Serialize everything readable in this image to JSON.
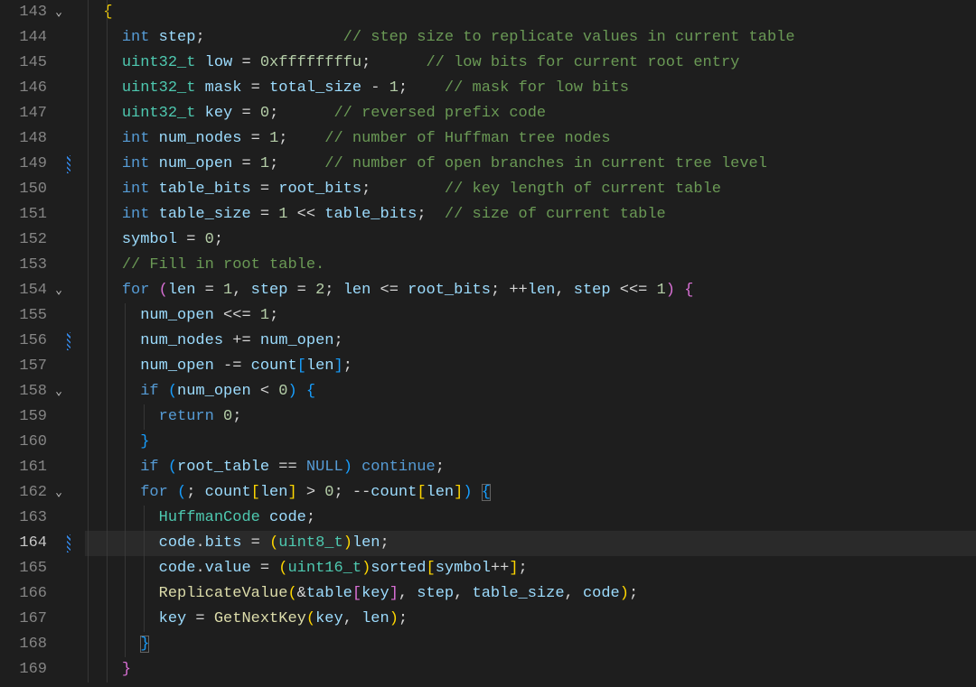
{
  "lines": [
    {
      "num": 143,
      "fold": "v",
      "marker": false,
      "indent": 1,
      "current": false,
      "guides": [
        0,
        1
      ],
      "tokens": [
        {
          "t": "{",
          "c": "braceY"
        }
      ]
    },
    {
      "num": 144,
      "fold": "",
      "marker": false,
      "indent": 2,
      "current": false,
      "guides": [
        0,
        1
      ],
      "tokens": [
        {
          "t": "int",
          "c": "keyword"
        },
        {
          "t": " ",
          "c": "default"
        },
        {
          "t": "step",
          "c": "var"
        },
        {
          "t": ";",
          "c": "punc"
        },
        {
          "t": "               ",
          "c": "default"
        },
        {
          "t": "// step size to replicate values in current table",
          "c": "comment"
        }
      ]
    },
    {
      "num": 145,
      "fold": "",
      "marker": false,
      "indent": 2,
      "current": false,
      "guides": [
        0,
        1
      ],
      "tokens": [
        {
          "t": "uint32_t",
          "c": "type"
        },
        {
          "t": " ",
          "c": "default"
        },
        {
          "t": "low",
          "c": "var"
        },
        {
          "t": " = ",
          "c": "punc"
        },
        {
          "t": "0xffffffffu",
          "c": "number"
        },
        {
          "t": ";",
          "c": "punc"
        },
        {
          "t": "      ",
          "c": "default"
        },
        {
          "t": "// low bits for current root entry",
          "c": "comment"
        }
      ]
    },
    {
      "num": 146,
      "fold": "",
      "marker": false,
      "indent": 2,
      "current": false,
      "guides": [
        0,
        1
      ],
      "tokens": [
        {
          "t": "uint32_t",
          "c": "type"
        },
        {
          "t": " ",
          "c": "default"
        },
        {
          "t": "mask",
          "c": "var"
        },
        {
          "t": " = ",
          "c": "punc"
        },
        {
          "t": "total_size",
          "c": "var"
        },
        {
          "t": " - ",
          "c": "punc"
        },
        {
          "t": "1",
          "c": "number"
        },
        {
          "t": ";",
          "c": "punc"
        },
        {
          "t": "    ",
          "c": "default"
        },
        {
          "t": "// mask for low bits",
          "c": "comment"
        }
      ]
    },
    {
      "num": 147,
      "fold": "",
      "marker": false,
      "indent": 2,
      "current": false,
      "guides": [
        0,
        1
      ],
      "tokens": [
        {
          "t": "uint32_t",
          "c": "type"
        },
        {
          "t": " ",
          "c": "default"
        },
        {
          "t": "key",
          "c": "var"
        },
        {
          "t": " = ",
          "c": "punc"
        },
        {
          "t": "0",
          "c": "number"
        },
        {
          "t": ";",
          "c": "punc"
        },
        {
          "t": "      ",
          "c": "default"
        },
        {
          "t": "// reversed prefix code",
          "c": "comment"
        }
      ]
    },
    {
      "num": 148,
      "fold": "",
      "marker": false,
      "indent": 2,
      "current": false,
      "guides": [
        0,
        1
      ],
      "tokens": [
        {
          "t": "int",
          "c": "keyword"
        },
        {
          "t": " ",
          "c": "default"
        },
        {
          "t": "num_nodes",
          "c": "var"
        },
        {
          "t": " = ",
          "c": "punc"
        },
        {
          "t": "1",
          "c": "number"
        },
        {
          "t": ";",
          "c": "punc"
        },
        {
          "t": "    ",
          "c": "default"
        },
        {
          "t": "// number of Huffman tree nodes",
          "c": "comment"
        }
      ]
    },
    {
      "num": 149,
      "fold": "",
      "marker": true,
      "indent": 2,
      "current": false,
      "guides": [
        0,
        1
      ],
      "tokens": [
        {
          "t": "int",
          "c": "keyword"
        },
        {
          "t": " ",
          "c": "default"
        },
        {
          "t": "num_open",
          "c": "var"
        },
        {
          "t": " = ",
          "c": "punc"
        },
        {
          "t": "1",
          "c": "number"
        },
        {
          "t": ";",
          "c": "punc"
        },
        {
          "t": "     ",
          "c": "default"
        },
        {
          "t": "// number of open branches in current tree level",
          "c": "comment"
        }
      ]
    },
    {
      "num": 150,
      "fold": "",
      "marker": false,
      "indent": 2,
      "current": false,
      "guides": [
        0,
        1
      ],
      "tokens": [
        {
          "t": "int",
          "c": "keyword"
        },
        {
          "t": " ",
          "c": "default"
        },
        {
          "t": "table_bits",
          "c": "var"
        },
        {
          "t": " = ",
          "c": "punc"
        },
        {
          "t": "root_bits",
          "c": "var"
        },
        {
          "t": ";",
          "c": "punc"
        },
        {
          "t": "        ",
          "c": "default"
        },
        {
          "t": "// key length of current table",
          "c": "comment"
        }
      ]
    },
    {
      "num": 151,
      "fold": "",
      "marker": false,
      "indent": 2,
      "current": false,
      "guides": [
        0,
        1
      ],
      "tokens": [
        {
          "t": "int",
          "c": "keyword"
        },
        {
          "t": " ",
          "c": "default"
        },
        {
          "t": "table_size",
          "c": "var"
        },
        {
          "t": " = ",
          "c": "punc"
        },
        {
          "t": "1",
          "c": "number"
        },
        {
          "t": " << ",
          "c": "punc"
        },
        {
          "t": "table_bits",
          "c": "var"
        },
        {
          "t": ";",
          "c": "punc"
        },
        {
          "t": "  ",
          "c": "default"
        },
        {
          "t": "// size of current table",
          "c": "comment"
        }
      ]
    },
    {
      "num": 152,
      "fold": "",
      "marker": false,
      "indent": 2,
      "current": false,
      "guides": [
        0,
        1
      ],
      "tokens": [
        {
          "t": "symbol",
          "c": "var"
        },
        {
          "t": " = ",
          "c": "punc"
        },
        {
          "t": "0",
          "c": "number"
        },
        {
          "t": ";",
          "c": "punc"
        }
      ]
    },
    {
      "num": 153,
      "fold": "",
      "marker": false,
      "indent": 2,
      "current": false,
      "guides": [
        0,
        1
      ],
      "tokens": [
        {
          "t": "// Fill in root table.",
          "c": "comment"
        }
      ]
    },
    {
      "num": 154,
      "fold": "v",
      "marker": false,
      "indent": 2,
      "current": false,
      "guides": [
        0,
        1
      ],
      "tokens": [
        {
          "t": "for",
          "c": "keyword"
        },
        {
          "t": " ",
          "c": "default"
        },
        {
          "t": "(",
          "c": "braceP"
        },
        {
          "t": "len",
          "c": "var"
        },
        {
          "t": " = ",
          "c": "punc"
        },
        {
          "t": "1",
          "c": "number"
        },
        {
          "t": ", ",
          "c": "punc"
        },
        {
          "t": "step",
          "c": "var"
        },
        {
          "t": " = ",
          "c": "punc"
        },
        {
          "t": "2",
          "c": "number"
        },
        {
          "t": "; ",
          "c": "punc"
        },
        {
          "t": "len",
          "c": "var"
        },
        {
          "t": " <= ",
          "c": "punc"
        },
        {
          "t": "root_bits",
          "c": "var"
        },
        {
          "t": "; ",
          "c": "punc"
        },
        {
          "t": "++",
          "c": "punc"
        },
        {
          "t": "len",
          "c": "var"
        },
        {
          "t": ", ",
          "c": "punc"
        },
        {
          "t": "step",
          "c": "var"
        },
        {
          "t": " <<= ",
          "c": "punc"
        },
        {
          "t": "1",
          "c": "number"
        },
        {
          "t": ")",
          "c": "braceP"
        },
        {
          "t": " ",
          "c": "default"
        },
        {
          "t": "{",
          "c": "braceP"
        }
      ]
    },
    {
      "num": 155,
      "fold": "",
      "marker": false,
      "indent": 3,
      "current": false,
      "guides": [
        0,
        1,
        2
      ],
      "tokens": [
        {
          "t": "num_open",
          "c": "var"
        },
        {
          "t": " <<= ",
          "c": "punc"
        },
        {
          "t": "1",
          "c": "number"
        },
        {
          "t": ";",
          "c": "punc"
        }
      ]
    },
    {
      "num": 156,
      "fold": "",
      "marker": true,
      "indent": 3,
      "current": false,
      "guides": [
        0,
        1,
        2
      ],
      "tokens": [
        {
          "t": "num_nodes",
          "c": "var"
        },
        {
          "t": " += ",
          "c": "punc"
        },
        {
          "t": "num_open",
          "c": "var"
        },
        {
          "t": ";",
          "c": "punc"
        }
      ]
    },
    {
      "num": 157,
      "fold": "",
      "marker": false,
      "indent": 3,
      "current": false,
      "guides": [
        0,
        1,
        2
      ],
      "tokens": [
        {
          "t": "num_open",
          "c": "var"
        },
        {
          "t": " -= ",
          "c": "punc"
        },
        {
          "t": "count",
          "c": "var"
        },
        {
          "t": "[",
          "c": "braceB"
        },
        {
          "t": "len",
          "c": "var"
        },
        {
          "t": "]",
          "c": "braceB"
        },
        {
          "t": ";",
          "c": "punc"
        }
      ]
    },
    {
      "num": 158,
      "fold": "v",
      "marker": false,
      "indent": 3,
      "current": false,
      "guides": [
        0,
        1,
        2
      ],
      "tokens": [
        {
          "t": "if",
          "c": "keyword"
        },
        {
          "t": " ",
          "c": "default"
        },
        {
          "t": "(",
          "c": "braceB"
        },
        {
          "t": "num_open",
          "c": "var"
        },
        {
          "t": " < ",
          "c": "punc"
        },
        {
          "t": "0",
          "c": "number"
        },
        {
          "t": ")",
          "c": "braceB"
        },
        {
          "t": " ",
          "c": "default"
        },
        {
          "t": "{",
          "c": "braceB"
        }
      ]
    },
    {
      "num": 159,
      "fold": "",
      "marker": false,
      "indent": 4,
      "current": false,
      "guides": [
        0,
        1,
        2,
        3
      ],
      "tokens": [
        {
          "t": "return",
          "c": "keyword"
        },
        {
          "t": " ",
          "c": "default"
        },
        {
          "t": "0",
          "c": "number"
        },
        {
          "t": ";",
          "c": "punc"
        }
      ]
    },
    {
      "num": 160,
      "fold": "",
      "marker": false,
      "indent": 3,
      "current": false,
      "guides": [
        0,
        1,
        2
      ],
      "tokens": [
        {
          "t": "}",
          "c": "braceB"
        }
      ]
    },
    {
      "num": 161,
      "fold": "",
      "marker": false,
      "indent": 3,
      "current": false,
      "guides": [
        0,
        1,
        2
      ],
      "tokens": [
        {
          "t": "if",
          "c": "keyword"
        },
        {
          "t": " ",
          "c": "default"
        },
        {
          "t": "(",
          "c": "braceB"
        },
        {
          "t": "root_table",
          "c": "var"
        },
        {
          "t": " == ",
          "c": "punc"
        },
        {
          "t": "NULL",
          "c": "const"
        },
        {
          "t": ")",
          "c": "braceB"
        },
        {
          "t": " ",
          "c": "default"
        },
        {
          "t": "continue",
          "c": "keyword"
        },
        {
          "t": ";",
          "c": "punc"
        }
      ]
    },
    {
      "num": 162,
      "fold": "v",
      "marker": false,
      "indent": 3,
      "current": false,
      "guides": [
        0,
        1,
        2
      ],
      "tokens": [
        {
          "t": "for",
          "c": "keyword"
        },
        {
          "t": " ",
          "c": "default"
        },
        {
          "t": "(",
          "c": "braceB"
        },
        {
          "t": "; ",
          "c": "punc"
        },
        {
          "t": "count",
          "c": "var"
        },
        {
          "t": "[",
          "c": "braceY"
        },
        {
          "t": "len",
          "c": "var"
        },
        {
          "t": "]",
          "c": "braceY"
        },
        {
          "t": " > ",
          "c": "punc"
        },
        {
          "t": "0",
          "c": "number"
        },
        {
          "t": "; ",
          "c": "punc"
        },
        {
          "t": "--",
          "c": "punc"
        },
        {
          "t": "count",
          "c": "var"
        },
        {
          "t": "[",
          "c": "braceY"
        },
        {
          "t": "len",
          "c": "var"
        },
        {
          "t": "]",
          "c": "braceY"
        },
        {
          "t": ")",
          "c": "braceB"
        },
        {
          "t": " ",
          "c": "default"
        },
        {
          "t": "{",
          "c": "braceB",
          "hl": true
        }
      ]
    },
    {
      "num": 163,
      "fold": "",
      "marker": false,
      "indent": 4,
      "current": false,
      "guides": [
        0,
        1,
        2,
        3
      ],
      "tokens": [
        {
          "t": "HuffmanCode",
          "c": "type"
        },
        {
          "t": " ",
          "c": "default"
        },
        {
          "t": "code",
          "c": "var"
        },
        {
          "t": ";",
          "c": "punc"
        }
      ]
    },
    {
      "num": 164,
      "fold": "",
      "marker": true,
      "indent": 4,
      "current": true,
      "guides": [
        0,
        1,
        2,
        3
      ],
      "tokens": [
        {
          "t": "code",
          "c": "var"
        },
        {
          "t": ".",
          "c": "punc"
        },
        {
          "t": "bits",
          "c": "var"
        },
        {
          "t": " = ",
          "c": "punc"
        },
        {
          "t": "(",
          "c": "braceY"
        },
        {
          "t": "uint8_t",
          "c": "type"
        },
        {
          "t": ")",
          "c": "braceY"
        },
        {
          "t": "len",
          "c": "var"
        },
        {
          "t": ";",
          "c": "punc"
        }
      ]
    },
    {
      "num": 165,
      "fold": "",
      "marker": false,
      "indent": 4,
      "current": false,
      "guides": [
        0,
        1,
        2,
        3
      ],
      "tokens": [
        {
          "t": "code",
          "c": "var"
        },
        {
          "t": ".",
          "c": "punc"
        },
        {
          "t": "value",
          "c": "var"
        },
        {
          "t": " = ",
          "c": "punc"
        },
        {
          "t": "(",
          "c": "braceY"
        },
        {
          "t": "uint16_t",
          "c": "type"
        },
        {
          "t": ")",
          "c": "braceY"
        },
        {
          "t": "sorted",
          "c": "var"
        },
        {
          "t": "[",
          "c": "braceY"
        },
        {
          "t": "symbol",
          "c": "var"
        },
        {
          "t": "++",
          "c": "punc"
        },
        {
          "t": "]",
          "c": "braceY"
        },
        {
          "t": ";",
          "c": "punc"
        }
      ]
    },
    {
      "num": 166,
      "fold": "",
      "marker": false,
      "indent": 4,
      "current": false,
      "guides": [
        0,
        1,
        2,
        3
      ],
      "tokens": [
        {
          "t": "ReplicateValue",
          "c": "func"
        },
        {
          "t": "(",
          "c": "braceY"
        },
        {
          "t": "&",
          "c": "punc"
        },
        {
          "t": "table",
          "c": "var"
        },
        {
          "t": "[",
          "c": "braceP"
        },
        {
          "t": "key",
          "c": "var"
        },
        {
          "t": "]",
          "c": "braceP"
        },
        {
          "t": ", ",
          "c": "punc"
        },
        {
          "t": "step",
          "c": "var"
        },
        {
          "t": ", ",
          "c": "punc"
        },
        {
          "t": "table_size",
          "c": "var"
        },
        {
          "t": ", ",
          "c": "punc"
        },
        {
          "t": "code",
          "c": "var"
        },
        {
          "t": ")",
          "c": "braceY"
        },
        {
          "t": ";",
          "c": "punc"
        }
      ]
    },
    {
      "num": 167,
      "fold": "",
      "marker": false,
      "indent": 4,
      "current": false,
      "guides": [
        0,
        1,
        2,
        3
      ],
      "tokens": [
        {
          "t": "key",
          "c": "var"
        },
        {
          "t": " = ",
          "c": "punc"
        },
        {
          "t": "GetNextKey",
          "c": "func"
        },
        {
          "t": "(",
          "c": "braceY"
        },
        {
          "t": "key",
          "c": "var"
        },
        {
          "t": ", ",
          "c": "punc"
        },
        {
          "t": "len",
          "c": "var"
        },
        {
          "t": ")",
          "c": "braceY"
        },
        {
          "t": ";",
          "c": "punc"
        }
      ]
    },
    {
      "num": 168,
      "fold": "",
      "marker": false,
      "indent": 3,
      "current": false,
      "guides": [
        0,
        1,
        2
      ],
      "tokens": [
        {
          "t": "}",
          "c": "braceB",
          "hl": true
        }
      ]
    },
    {
      "num": 169,
      "fold": "",
      "marker": false,
      "indent": 2,
      "current": false,
      "guides": [
        0,
        1
      ],
      "tokens": [
        {
          "t": "}",
          "c": "braceP"
        }
      ]
    }
  ],
  "chevron": "⌄",
  "indentWidth": 2,
  "charWidth": 10.25
}
